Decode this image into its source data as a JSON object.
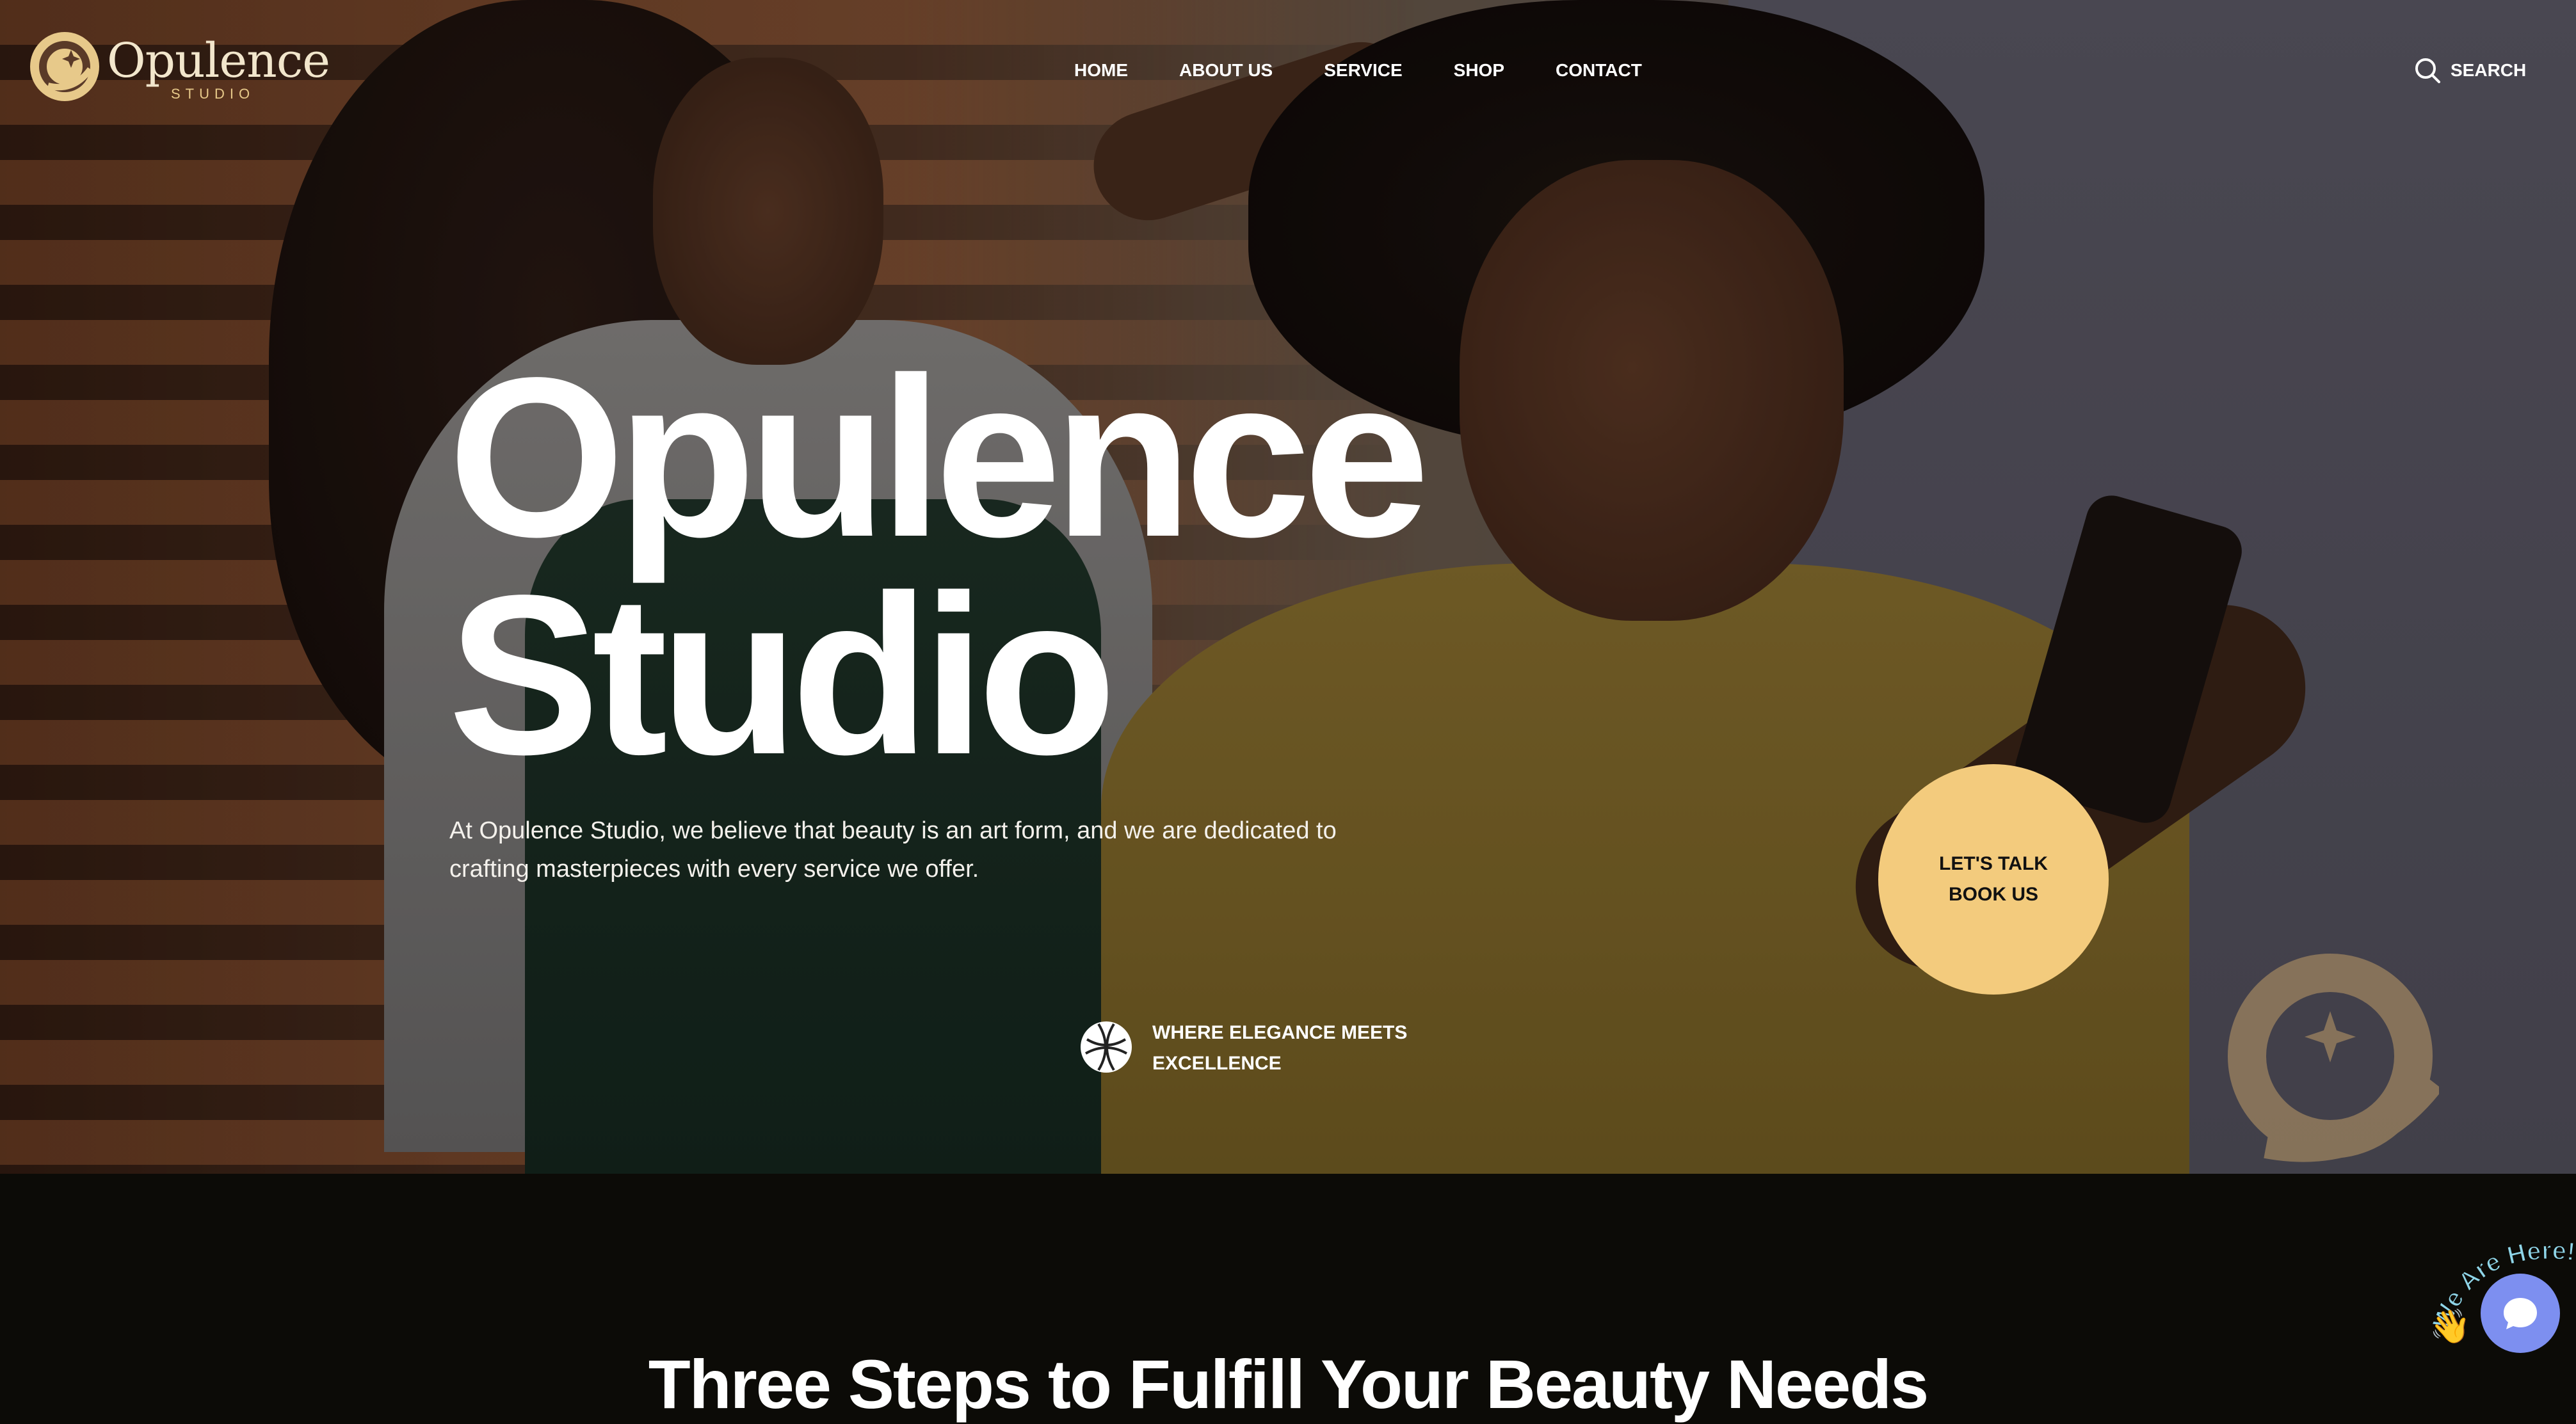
{
  "brand": {
    "name": "Opulence",
    "sub": "STUDIO",
    "accent": "#f3cb7d"
  },
  "nav": {
    "items": [
      {
        "label": "HOME"
      },
      {
        "label": "ABOUT US"
      },
      {
        "label": "SERVICE"
      },
      {
        "label": "SHOP"
      },
      {
        "label": "CONTACT"
      }
    ],
    "search_label": "SEARCH",
    "search_icon": "search-icon"
  },
  "hero": {
    "title_line1": "Opulence",
    "title_line2": "Studio",
    "intro": "At Opulence Studio, we believe that beauty is an art form, and we are dedicated to crafting masterpieces with every service we offer.",
    "cta_line1": "LET'S TALK",
    "cta_line2": "BOOK US",
    "tagline": "WHERE ELEGANCE MEETS EXCELLENCE",
    "tag_icon": "globe-icon"
  },
  "section": {
    "heading": "Three Steps to Fulfill Your Beauty Needs"
  },
  "chat": {
    "label": "We Are Here!",
    "wave": "👋",
    "icon": "chat-bubble-icon",
    "color": "#7d8ff0"
  }
}
